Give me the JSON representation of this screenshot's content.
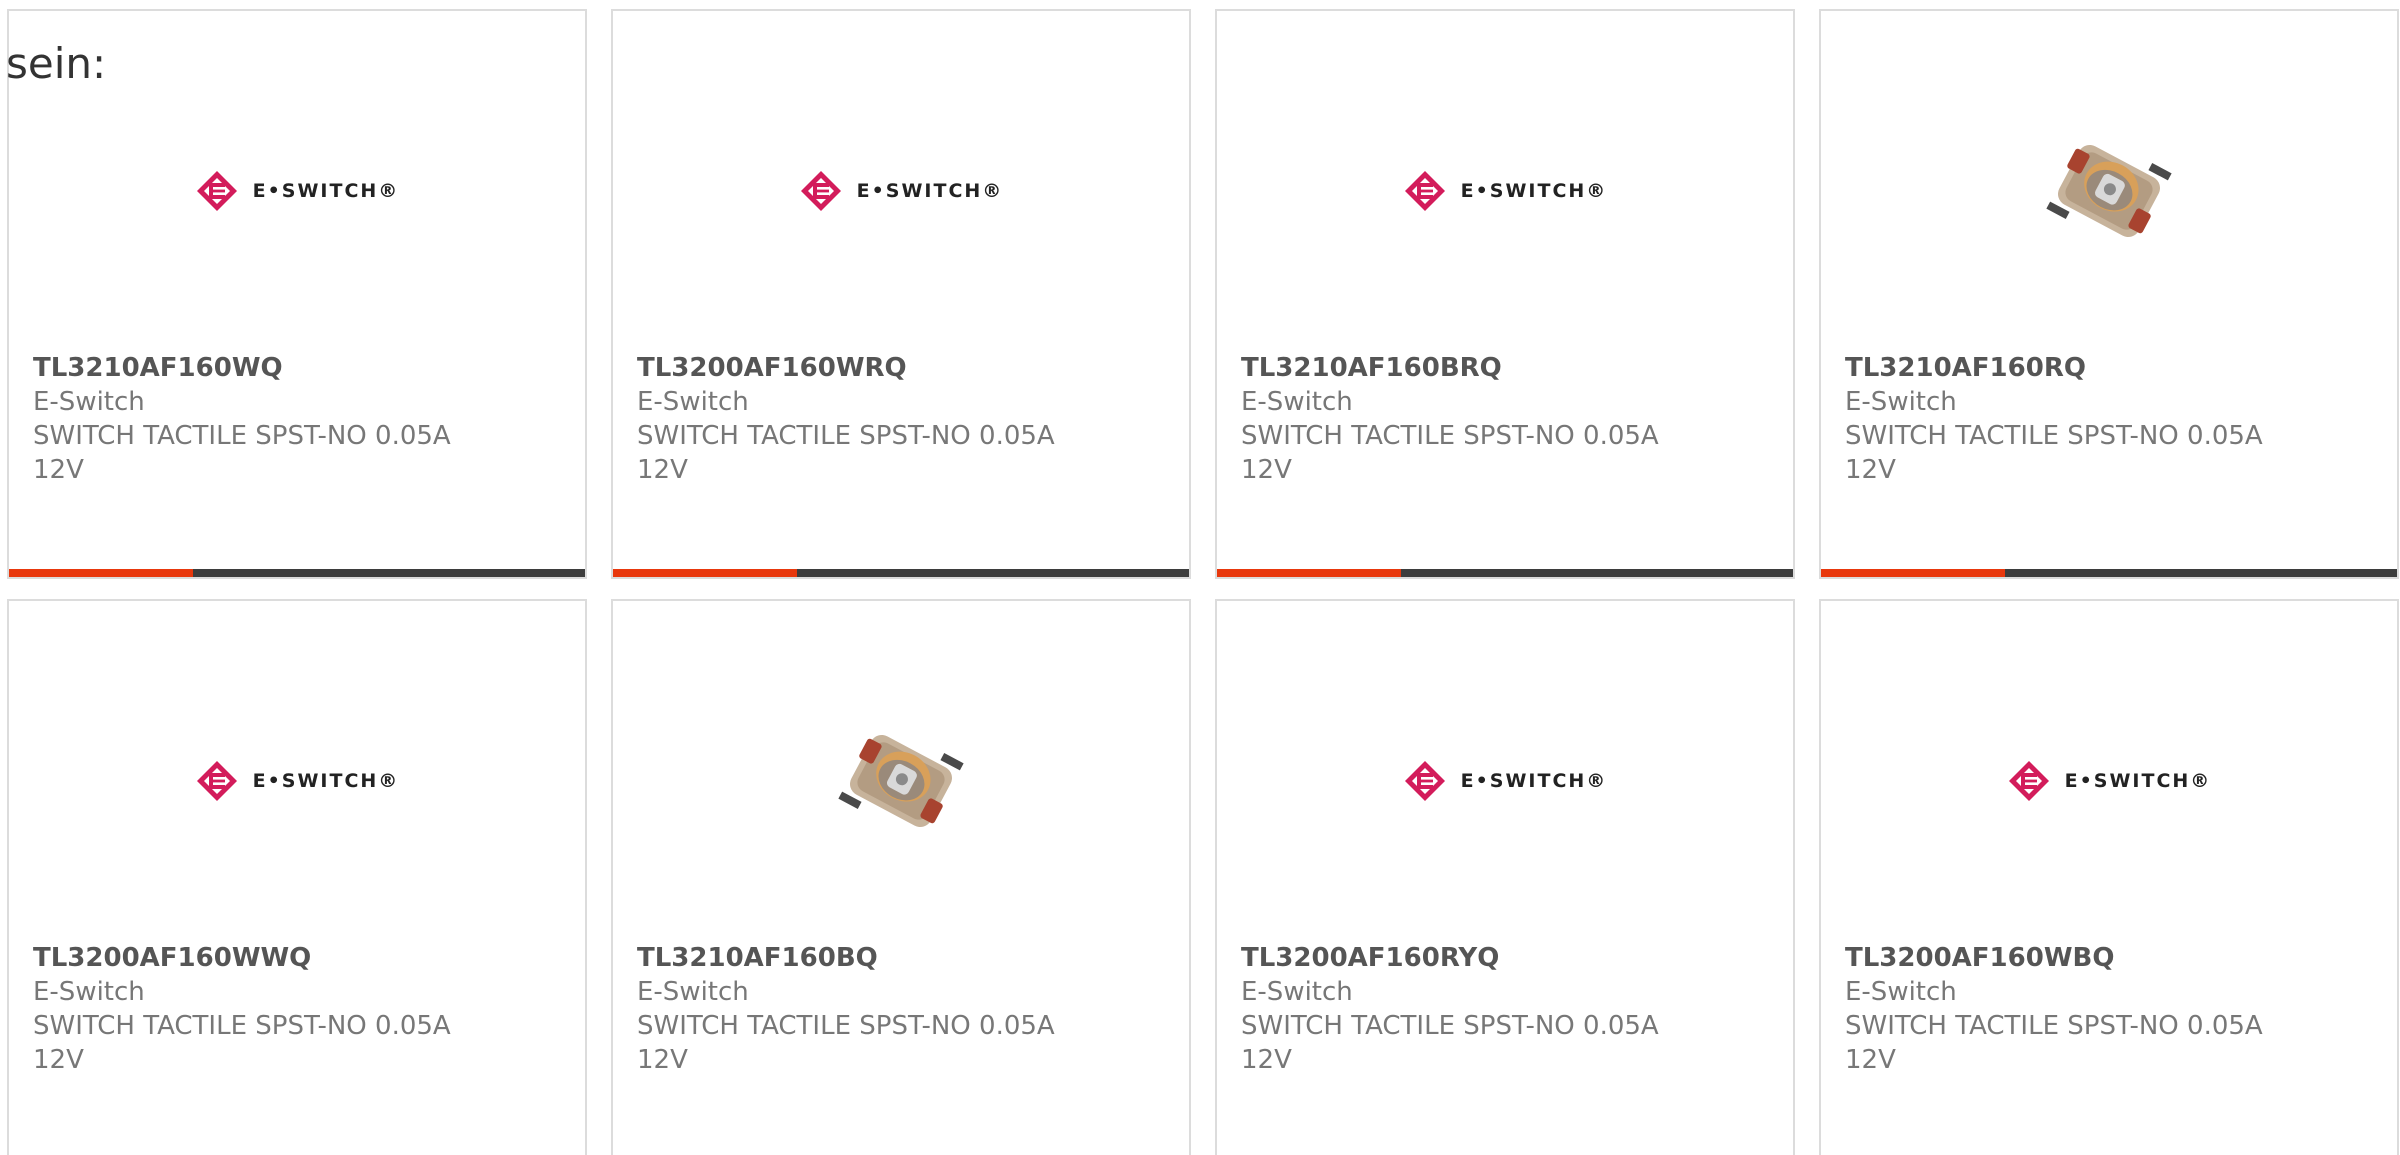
{
  "intro_text": "sein:",
  "logo_text": "E•SWITCH®",
  "colors": {
    "accent": "#e8380d",
    "bar": "#3d3d3d",
    "logo_red": "#d31c5b"
  },
  "cards": [
    {
      "part": "TL3210AF160WQ",
      "manufacturer": "E-Switch",
      "description": "SWITCH TACTILE SPST-NO 0.05A 12V",
      "image": "logo-icon",
      "progress": 0.32
    },
    {
      "part": "TL3200AF160WRQ",
      "manufacturer": "E-Switch",
      "description": "SWITCH TACTILE SPST-NO 0.05A 12V",
      "image": "logo-icon",
      "progress": 0.32
    },
    {
      "part": "TL3210AF160BRQ",
      "manufacturer": "E-Switch",
      "description": "SWITCH TACTILE SPST-NO 0.05A 12V",
      "image": "logo-icon",
      "progress": 0.32
    },
    {
      "part": "TL3210AF160RQ",
      "manufacturer": "E-Switch",
      "description": "SWITCH TACTILE SPST-NO 0.05A 12V",
      "image": "product-photo-icon",
      "progress": 0.32
    },
    {
      "part": "TL3200AF160WWQ",
      "manufacturer": "E-Switch",
      "description": "SWITCH TACTILE SPST-NO 0.05A 12V",
      "image": "logo-icon"
    },
    {
      "part": "TL3210AF160BQ",
      "manufacturer": "E-Switch",
      "description": "SWITCH TACTILE SPST-NO 0.05A 12V",
      "image": "product-photo-icon"
    },
    {
      "part": "TL3200AF160RYQ",
      "manufacturer": "E-Switch",
      "description": "SWITCH TACTILE SPST-NO 0.05A 12V",
      "image": "logo-icon"
    },
    {
      "part": "TL3200AF160WBQ",
      "manufacturer": "E-Switch",
      "description": "SWITCH TACTILE SPST-NO 0.05A 12V",
      "image": "logo-icon"
    }
  ]
}
